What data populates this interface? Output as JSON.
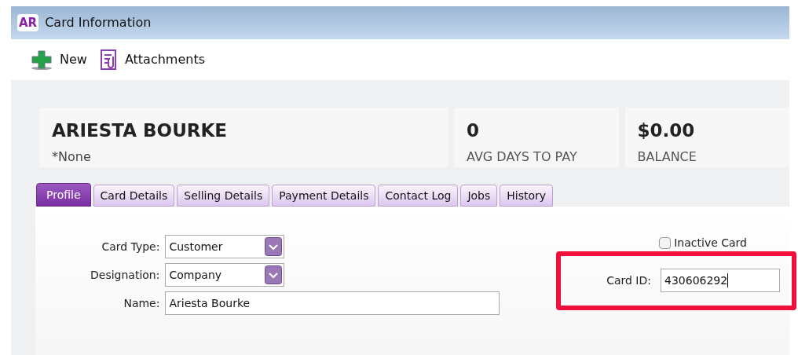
{
  "window": {
    "app_badge": "AR",
    "title": "Card Information"
  },
  "toolbar": [
    {
      "kind": "new",
      "label": "New"
    },
    {
      "kind": "attach",
      "label": "Attachments"
    }
  ],
  "header": {
    "name": "ARIESTA BOURKE",
    "subtitle": "*None",
    "stats": [
      {
        "value": "0",
        "label": "AVG DAYS TO PAY"
      },
      {
        "value": "$0.00",
        "label": "BALANCE"
      }
    ]
  },
  "tabs": [
    {
      "label": "Profile",
      "selected": true
    },
    {
      "label": "Card Details",
      "selected": false
    },
    {
      "label": "Selling Details",
      "selected": false
    },
    {
      "label": "Payment Details",
      "selected": false
    },
    {
      "label": "Contact Log",
      "selected": false
    },
    {
      "label": "Jobs",
      "selected": false
    },
    {
      "label": "History",
      "selected": false
    }
  ],
  "form": {
    "fields": [
      {
        "kind": "select",
        "label": "Card Type:",
        "value": "Customer"
      },
      {
        "kind": "select",
        "label": "Designation:",
        "value": "Company"
      },
      {
        "kind": "text",
        "label": "Name:",
        "value": "Ariesta Bourke"
      }
    ],
    "inactive": {
      "label": "Inactive Card",
      "checked": false
    },
    "card_id": {
      "label": "Card ID:",
      "value": "430606292",
      "highlighted": true
    }
  }
}
